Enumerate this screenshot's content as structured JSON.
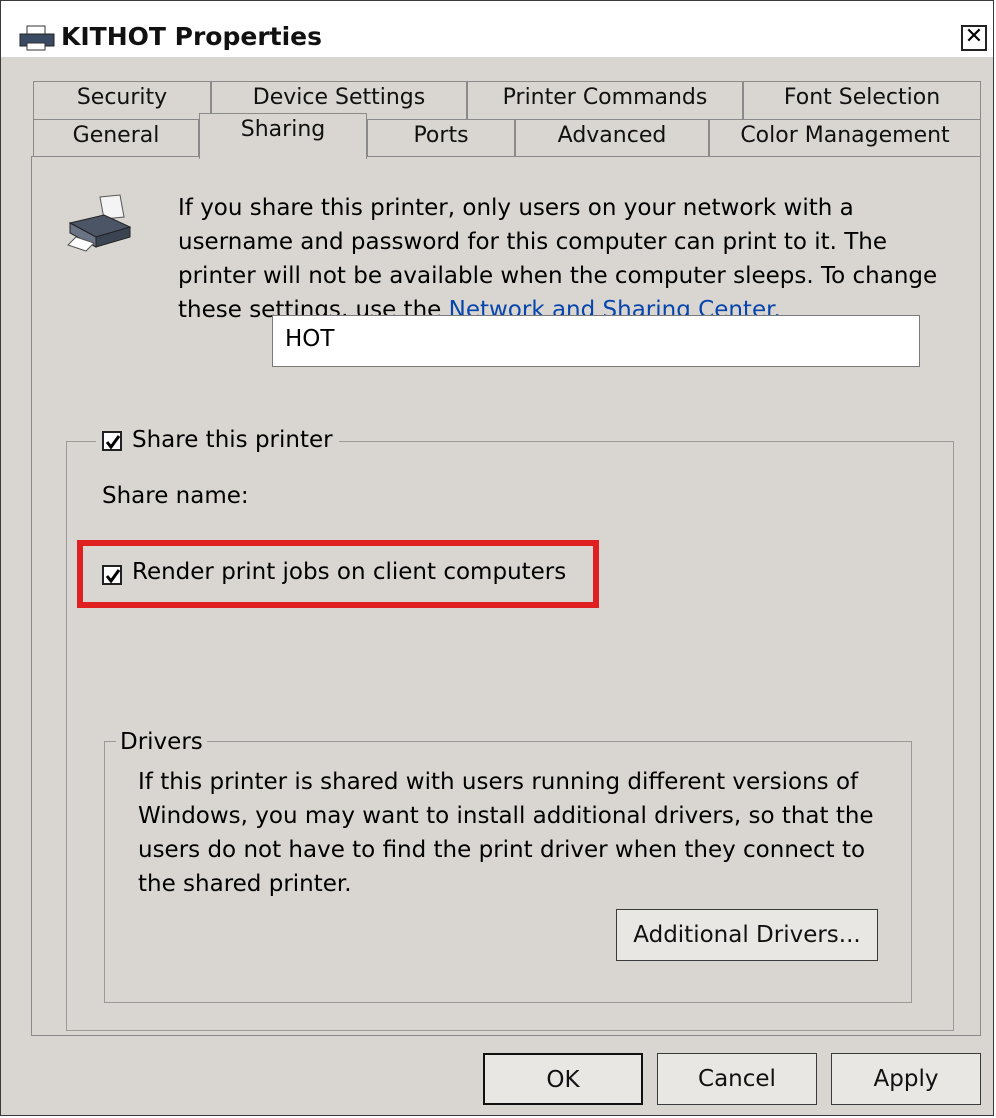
{
  "window": {
    "title": "KITHOT Properties",
    "close_glyph": "✕"
  },
  "tabs": {
    "back_row": [
      "Security",
      "Device Settings",
      "Printer Commands",
      "Font Selection"
    ],
    "front_row": [
      "General",
      "Sharing",
      "Ports",
      "Advanced",
      "Color Management"
    ],
    "active": "Sharing"
  },
  "sharing": {
    "intro_text": "If you share this printer, only users on your network with a username and password for this computer can print to it. The printer will not be available when the computer sleeps. To change these settings, use the ",
    "intro_link": "Network and Sharing Center.",
    "share_checkbox_label": "Share this printer",
    "share_checked": true,
    "share_name_label": "Share name:",
    "share_name_value": "HOT",
    "render_checkbox_label": "Render print jobs on client computers",
    "render_checked": true
  },
  "drivers": {
    "legend": "Drivers",
    "text": "If this printer is shared with users running different versions of Windows, you may want to install additional drivers, so that the users do not have to find the print driver when they connect to the shared printer.",
    "button_label": "Additional Drivers..."
  },
  "footer": {
    "ok_label": "OK",
    "cancel_label": "Cancel",
    "apply_label": "Apply"
  },
  "colors": {
    "dialog_bg": "#d9d6d1",
    "link": "#0645ad",
    "highlight": "#e02020"
  },
  "icons": [
    "printer-icon",
    "close-icon",
    "checkbox-checked-icon"
  ]
}
